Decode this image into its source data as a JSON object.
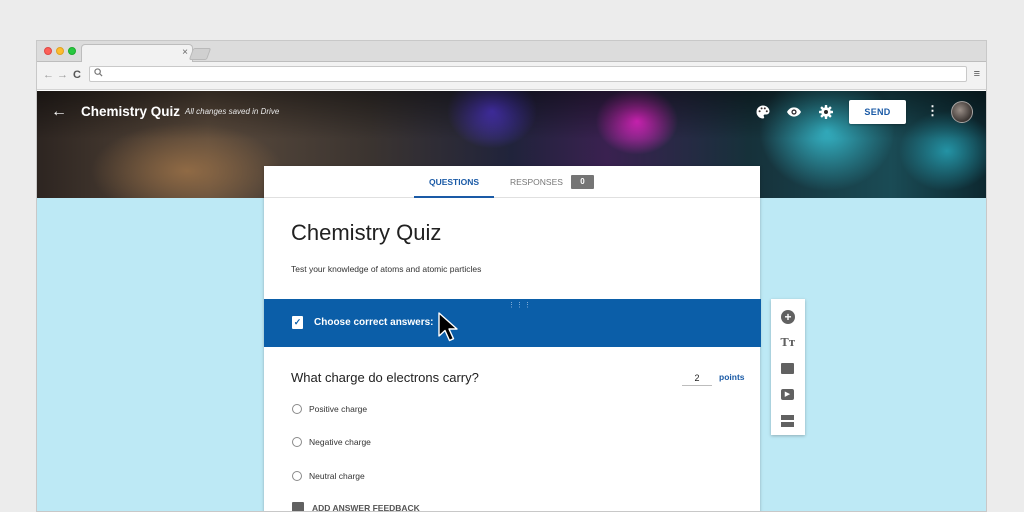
{
  "browser": {
    "tab_close": "×",
    "nav_back": "←",
    "nav_forward": "→",
    "nav_reload": "C",
    "address_value": "",
    "search_icon": "search-icon",
    "menu_icon": "≡"
  },
  "header": {
    "back_icon": "←",
    "title": "Chemistry Quiz",
    "saved_note": "All changes saved in Drive",
    "send_label": "SEND",
    "more_icon": "⋮",
    "palette_icon": "palette-icon",
    "preview_icon": "eye-icon",
    "settings_icon": "gear-icon"
  },
  "tabs": {
    "questions_label": "QUESTIONS",
    "responses_label": "RESPONSES",
    "responses_count": "0"
  },
  "form": {
    "title": "Chemistry Quiz",
    "description": "Test your knowledge of atoms and atomic particles"
  },
  "answer_key": {
    "label": "Choose correct answers:",
    "drag_handle": "⋮⋮⋮"
  },
  "question": {
    "text": "What charge do electrons carry?",
    "points_value": "2",
    "points_label": "points",
    "options": [
      "Positive charge",
      "Negative charge",
      "Neutral charge"
    ],
    "feedback_label": "ADD ANSWER FEEDBACK"
  },
  "side_toolbar": {
    "add_icon": "+",
    "title_icon": "Tт"
  },
  "colors": {
    "accent": "#1a5aa6",
    "banner": "#0b5ea8",
    "canvas": "#bde9f5"
  }
}
